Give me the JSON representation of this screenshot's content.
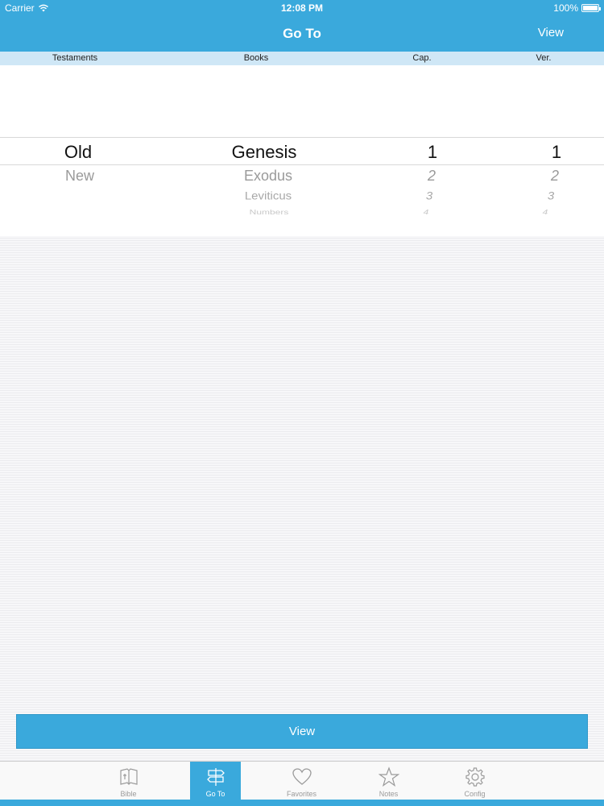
{
  "status_bar": {
    "carrier": "Carrier",
    "time": "12:08 PM",
    "battery": "100%"
  },
  "nav": {
    "title": "Go To",
    "right_button": "View"
  },
  "columns": {
    "testaments": "Testaments",
    "books": "Books",
    "chapter": "Cap.",
    "verse": "Ver."
  },
  "picker": {
    "testaments": [
      "Old",
      "New"
    ],
    "books": [
      "Genesis",
      "Exodus",
      "Leviticus",
      "Numbers"
    ],
    "chapters": [
      "1",
      "2",
      "3",
      "4"
    ],
    "verses": [
      "1",
      "2",
      "3",
      "4"
    ]
  },
  "view_button": "View",
  "tabs": [
    {
      "label": "Bible",
      "icon": "open-book-icon"
    },
    {
      "label": "Go To",
      "icon": "signpost-icon",
      "active": true
    },
    {
      "label": "Favorites",
      "icon": "heart-icon"
    },
    {
      "label": "Notes",
      "icon": "star-icon"
    },
    {
      "label": "Config",
      "icon": "gear-icon"
    }
  ],
  "colors": {
    "accent": "#3aa9dc",
    "header_row": "#cfe7f6"
  }
}
